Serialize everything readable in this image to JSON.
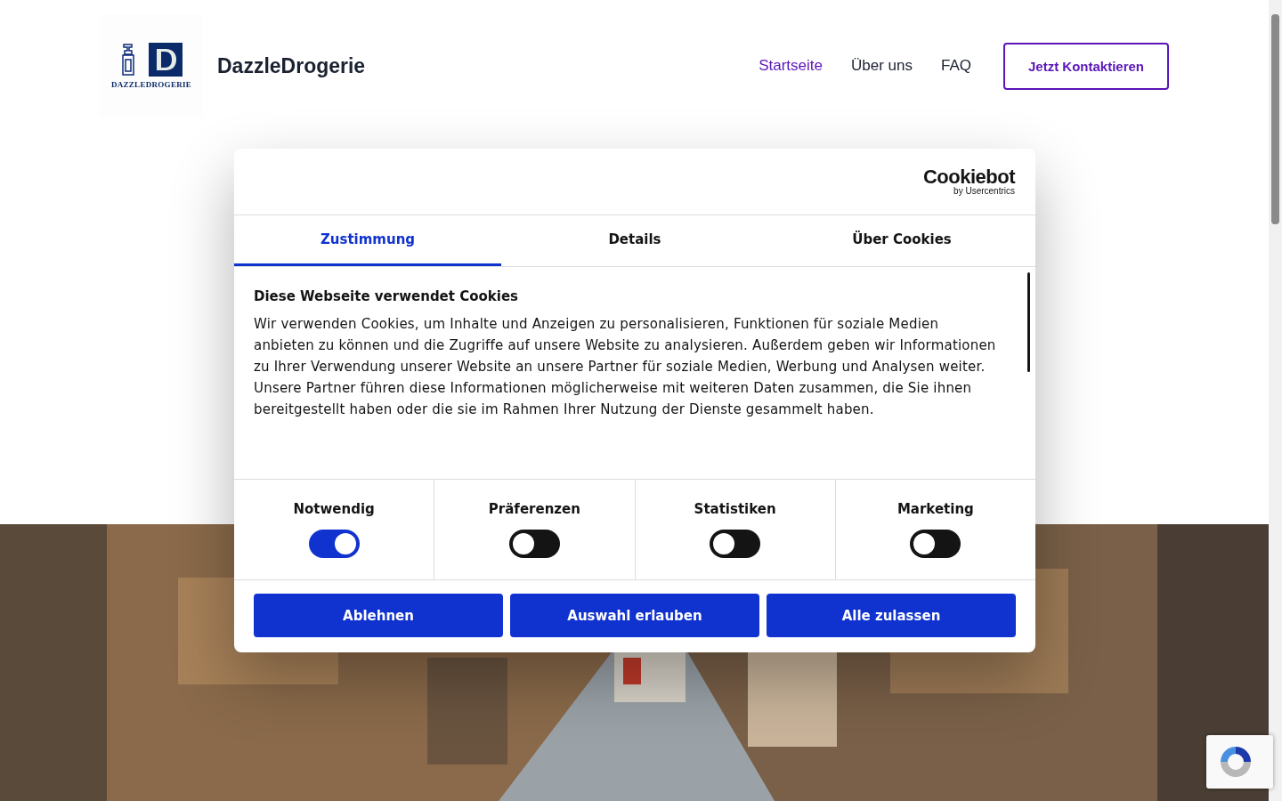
{
  "header": {
    "logo_text": "DAZZLEDROGERIE",
    "brand": "DazzleDrogerie",
    "nav": [
      {
        "label": "Startseite",
        "selected": true
      },
      {
        "label": "Über uns",
        "selected": false
      },
      {
        "label": "FAQ",
        "selected": false
      }
    ],
    "cta": "Jetzt Kontaktieren"
  },
  "cookie_dialog": {
    "logo": "Cookiebot",
    "logo_sub": "by Usercentrics",
    "tabs": [
      {
        "label": "Zustimmung",
        "selected": true
      },
      {
        "label": "Details",
        "selected": false
      },
      {
        "label": "Über Cookies",
        "selected": false
      }
    ],
    "heading": "Diese Webseite verwendet Cookies",
    "body": "Wir verwenden Cookies, um Inhalte und Anzeigen zu personalisieren, Funktionen für soziale Medien anbieten zu können und die Zugriffe auf unsere Website zu analysieren. Außerdem geben wir Informationen zu Ihrer Verwendung unserer Website an unsere Partner für soziale Medien, Werbung und Analysen weiter. Unsere Partner führen diese Informationen möglicherweise mit weiteren Daten zusammen, die Sie ihnen bereitgestellt haben oder die sie im Rahmen Ihrer Nutzung der Dienste gesammelt haben.",
    "categories": [
      {
        "label": "Notwendig",
        "checked": true
      },
      {
        "label": "Präferenzen",
        "checked": false
      },
      {
        "label": "Statistiken",
        "checked": false
      },
      {
        "label": "Marketing",
        "checked": false
      }
    ],
    "buttons": [
      "Ablehnen",
      "Auswahl erlauben",
      "Alle zulassen"
    ]
  }
}
